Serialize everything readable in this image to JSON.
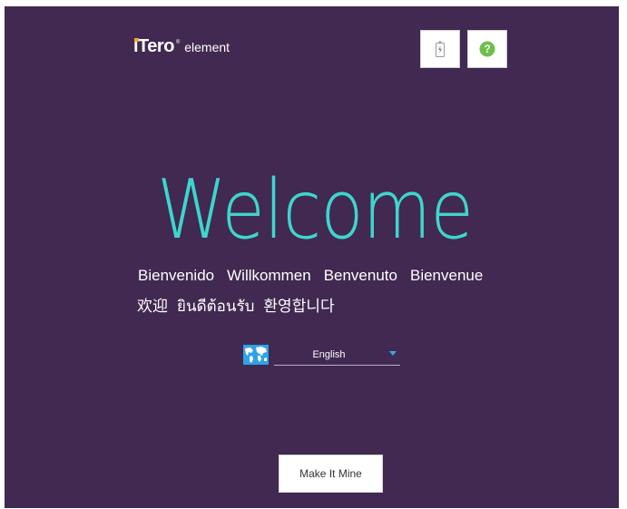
{
  "brand": {
    "name": "iTero",
    "registered_mark": "®",
    "sub": "element"
  },
  "toolbar": {
    "battery_icon": "battery-charging-icon",
    "help_icon": "help-question-icon",
    "help_color": "#6cc04a"
  },
  "welcome": {
    "title": "Welcome",
    "translations_row1": [
      "Bienvenido",
      "Willkommen",
      "Benvenuto",
      "Bienvenue"
    ],
    "translations_row2": [
      "欢迎",
      "ยินดีต้อนรับ",
      "환영합니다"
    ]
  },
  "language": {
    "icon": "globe-map-icon",
    "selected": "English"
  },
  "actions": {
    "primary_label": "Make It Mine"
  },
  "colors": {
    "background": "#412951",
    "accent": "#3dd6cc",
    "dropdown_caret": "#3aa9e0"
  }
}
